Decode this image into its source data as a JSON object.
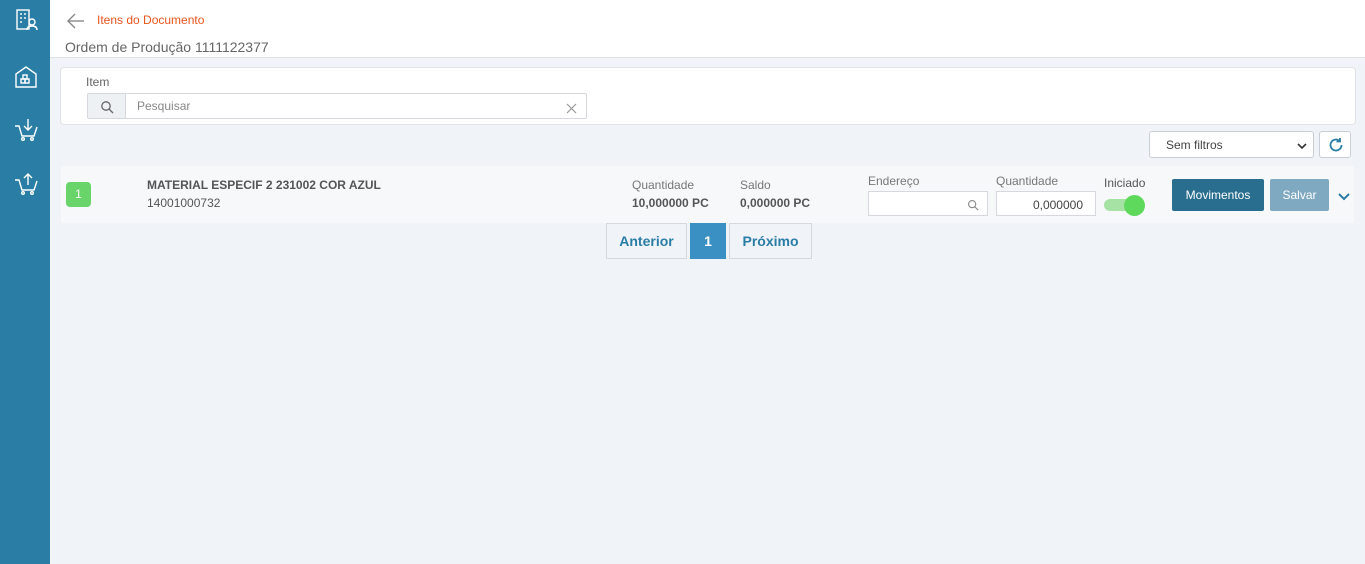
{
  "sidebar": {
    "items": [
      {
        "name": "building-user-icon"
      },
      {
        "name": "warehouse-icon"
      },
      {
        "name": "cart-in-icon"
      },
      {
        "name": "cart-out-icon"
      }
    ]
  },
  "header": {
    "breadcrumb": "Itens do Documento",
    "title": "Ordem de Produção 1111122377"
  },
  "filter": {
    "label": "Item",
    "search_placeholder": "Pesquisar",
    "select_value": "Sem filtros"
  },
  "item": {
    "index": "1",
    "name": "MATERIAL ESPECIF 2 231002 COR AZUL",
    "code": "14001000732",
    "quantidade_label": "Quantidade",
    "quantidade_value": "10,000000 PC",
    "saldo_label": "Saldo",
    "saldo_value": "0,000000 PC",
    "endereco_label": "Endereço",
    "quantidade_input_label": "Quantidade",
    "quantidade_input_value": "0,000000",
    "iniciado_label": "Iniciado",
    "iniciado_on": true,
    "movimentos_label": "Movimentos",
    "salvar_label": "Salvar"
  },
  "pagination": {
    "prev_label": "Anterior",
    "current_page": "1",
    "next_label": "Próximo"
  },
  "colors": {
    "sidebar": "#2a7ea6",
    "accent": "#e8541e",
    "success": "#68d46a",
    "primary_button": "#2a6e8f"
  }
}
